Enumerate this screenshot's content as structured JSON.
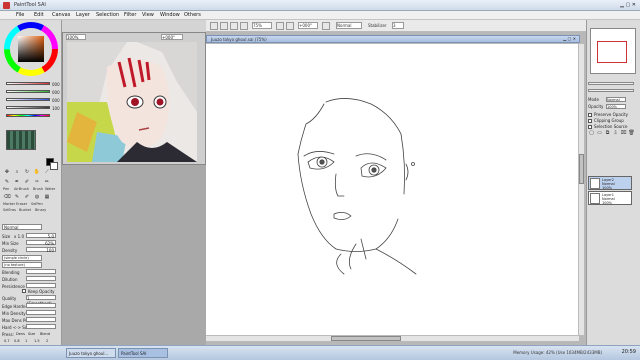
{
  "window": {
    "title": "PaintTool SAI"
  },
  "menu": [
    "File",
    "Edit",
    "Canvas",
    "Layer",
    "Selection",
    "Filter",
    "View",
    "Window",
    "Others"
  ],
  "toolbar": {
    "zoom": "75%",
    "angle": "+000°",
    "mode": "Normal",
    "stab_label": "Stabilizer",
    "stab_value": "3"
  },
  "navigator": {
    "zoom": "100%",
    "angle": "+000°"
  },
  "color": {
    "sliders": [
      {
        "label": "H",
        "value": "000",
        "color": "#d83030"
      },
      {
        "label": "S",
        "value": "000",
        "color": "#30b030"
      },
      {
        "label": "V",
        "value": "000",
        "color": "#3050d8"
      },
      {
        "label": "A",
        "value": "100",
        "color": "#333333"
      }
    ],
    "primary": "#000000",
    "secondary": "#ffffff"
  },
  "tools": {
    "labels": [
      "Pen",
      "AirBrush",
      "Brush",
      "Water",
      "Marker",
      "Eraser",
      "SelPen",
      "SelEras",
      "Bucket",
      "Binary"
    ]
  },
  "brush": {
    "mode": "Normal",
    "size_label": "Size",
    "size_mult": "x 1.0",
    "size_value": "5.0",
    "min_size_label": "Min Size",
    "min_size_value": "62%",
    "density_label": "Density",
    "density_value": "100",
    "shape": "(simple circle)",
    "texture": "(no texture)",
    "blending_label": "Blending",
    "dilution_label": "Dilution",
    "persistence_label": "Persistence",
    "keep_opacity_label": "Keep Opacity",
    "quality_label": "Quality",
    "quality_value": "1 (Smoothest)",
    "edge_label": "Edge Hardness",
    "min_density_label": "Min Density",
    "max_dens_label": "Max Dens Prs.",
    "hard_soft_label": "Hard <-> Soft",
    "press_label": "Press:",
    "press_checks": [
      "Dens",
      "Size",
      "Blend"
    ],
    "sizes": [
      "0.7",
      "0.8",
      "1",
      "1.5",
      "2"
    ]
  },
  "document": {
    "title": "Juuzo tokyo ghoul.sai (75%)"
  },
  "layers_panel": {
    "opacity_label": "Opacity",
    "opacity_value": "100%",
    "mode_label": "Mode",
    "mode_value": "Normal",
    "preserve_label": "Preserve Opacity",
    "clipping_label": "Clipping Group",
    "selection_source_label": "Selection Source",
    "layers": [
      {
        "name": "Layer2",
        "mode": "Normal",
        "opacity": "100%",
        "selected": true
      },
      {
        "name": "Layer1",
        "mode": "Normal",
        "opacity": "100%",
        "selected": false
      }
    ]
  },
  "taskbar": {
    "tasks": [
      "Juuzo tokyo ghoul...",
      "PaintTool SAI"
    ],
    "status": "Memory Usage: 42% (Use 1034MB/2433MB)",
    "clock": "20:59"
  }
}
